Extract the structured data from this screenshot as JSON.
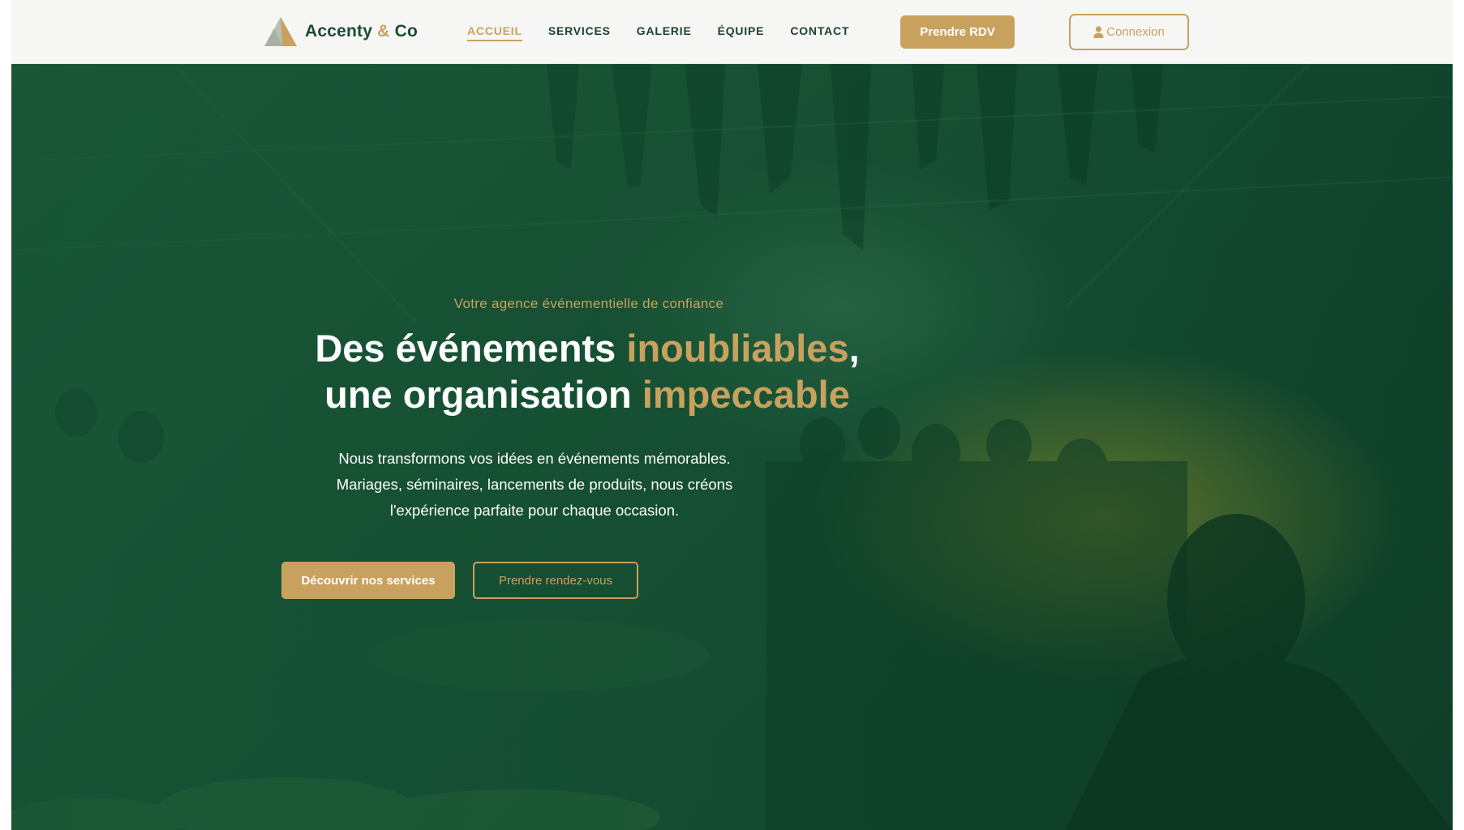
{
  "brand": {
    "name_part1": "Accenty",
    "ampersand": "&",
    "name_part2": "Co",
    "logo_icon": "triangle-mountain-logo"
  },
  "nav": {
    "items": [
      {
        "label": "ACCUEIL",
        "active": true
      },
      {
        "label": "SERVICES",
        "active": false
      },
      {
        "label": "GALERIE",
        "active": false
      },
      {
        "label": "ÉQUIPE",
        "active": false
      },
      {
        "label": "CONTACT",
        "active": false
      }
    ]
  },
  "header": {
    "cta_label": "Prendre RDV",
    "login_label": "Connexion",
    "login_icon": "user-icon"
  },
  "hero": {
    "eyebrow": "Votre agence événementielle de confiance",
    "headline": {
      "line1_start": "Des événements ",
      "line1_highlight": "inoubliables",
      "line1_end": ",",
      "line2_start": "une organisation ",
      "line2_highlight": "impeccable"
    },
    "lead_lines": [
      "Nous transformons vos idées en événements mémorables.",
      "Mariages, séminaires, lancements de produits, nous créons",
      "l'expérience parfaite pour chaque occasion."
    ],
    "primary_button": "Découvrir nos services",
    "secondary_button": "Prendre rendez-vous"
  },
  "colors": {
    "brand_green": "#1e4a36",
    "accent_gold": "#c9a15e",
    "hero_green": "#174f33",
    "header_bg": "#f6f7f5"
  }
}
